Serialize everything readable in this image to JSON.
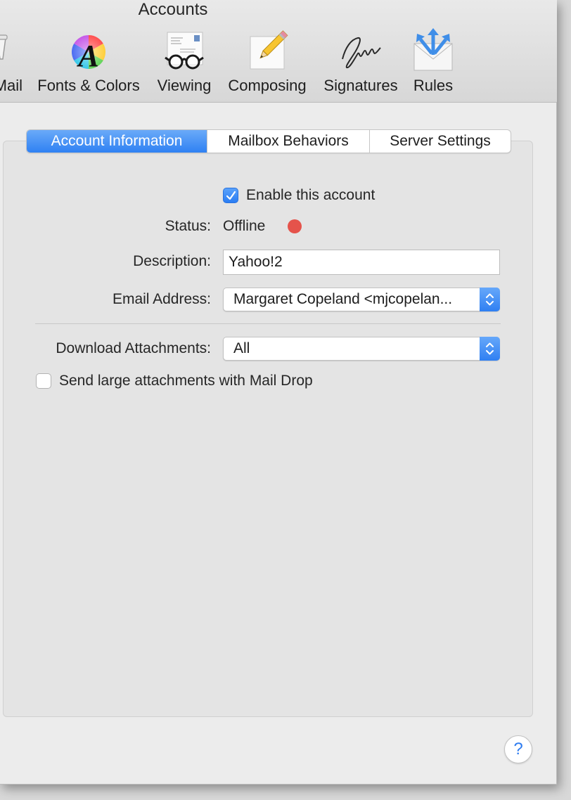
{
  "window": {
    "title": "Accounts"
  },
  "toolbar": {
    "items": [
      {
        "label": "Mail",
        "icon": "mail-general-icon"
      },
      {
        "label": "Fonts & Colors",
        "icon": "fonts-colors-icon"
      },
      {
        "label": "Viewing",
        "icon": "viewing-glasses-icon"
      },
      {
        "label": "Composing",
        "icon": "composing-pencil-icon"
      },
      {
        "label": "Signatures",
        "icon": "signature-icon"
      },
      {
        "label": "Rules",
        "icon": "rules-envelope-icon"
      }
    ]
  },
  "tabs": [
    {
      "label": "Account Information",
      "active": true
    },
    {
      "label": "Mailbox Behaviors",
      "active": false
    },
    {
      "label": "Server Settings",
      "active": false
    }
  ],
  "form": {
    "enable_account": {
      "label": "Enable this account",
      "checked": true
    },
    "status": {
      "label": "Status:",
      "value": "Offline",
      "dot_color": "#e5534b"
    },
    "description": {
      "label": "Description:",
      "value": "Yahoo!2"
    },
    "email_address": {
      "label": "Email Address:",
      "value": "Margaret Copeland <mjcopelan..."
    },
    "download_attachments": {
      "label": "Download Attachments:",
      "value": "All"
    },
    "mail_drop": {
      "label": "Send large attachments with Mail Drop",
      "checked": false
    }
  },
  "help": {
    "symbol": "?"
  },
  "colors": {
    "accent": "#2f81f3",
    "status_offline": "#e5534b"
  }
}
